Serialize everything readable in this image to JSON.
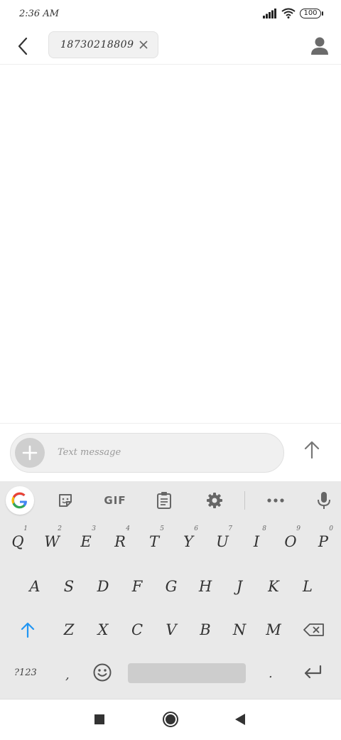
{
  "status": {
    "time": "2:36 AM",
    "battery": "100"
  },
  "header": {
    "recipient": "18730218809"
  },
  "composer": {
    "placeholder": "Text message"
  },
  "keyboard": {
    "toolbar": {
      "gif_label": "GIF"
    },
    "row1": [
      {
        "letter": "Q",
        "hint": "1"
      },
      {
        "letter": "W",
        "hint": "2"
      },
      {
        "letter": "E",
        "hint": "3"
      },
      {
        "letter": "R",
        "hint": "4"
      },
      {
        "letter": "T",
        "hint": "5"
      },
      {
        "letter": "Y",
        "hint": "6"
      },
      {
        "letter": "U",
        "hint": "7"
      },
      {
        "letter": "I",
        "hint": "8"
      },
      {
        "letter": "O",
        "hint": "9"
      },
      {
        "letter": "P",
        "hint": "0"
      }
    ],
    "row2": [
      "A",
      "S",
      "D",
      "F",
      "G",
      "H",
      "J",
      "K",
      "L"
    ],
    "row3": [
      "Z",
      "X",
      "C",
      "V",
      "B",
      "N",
      "M"
    ],
    "symbols_label": "?123",
    "comma": ",",
    "period": "."
  },
  "colors": {
    "accent": "#2196f3",
    "keyboard_bg": "#e9e9e9"
  }
}
